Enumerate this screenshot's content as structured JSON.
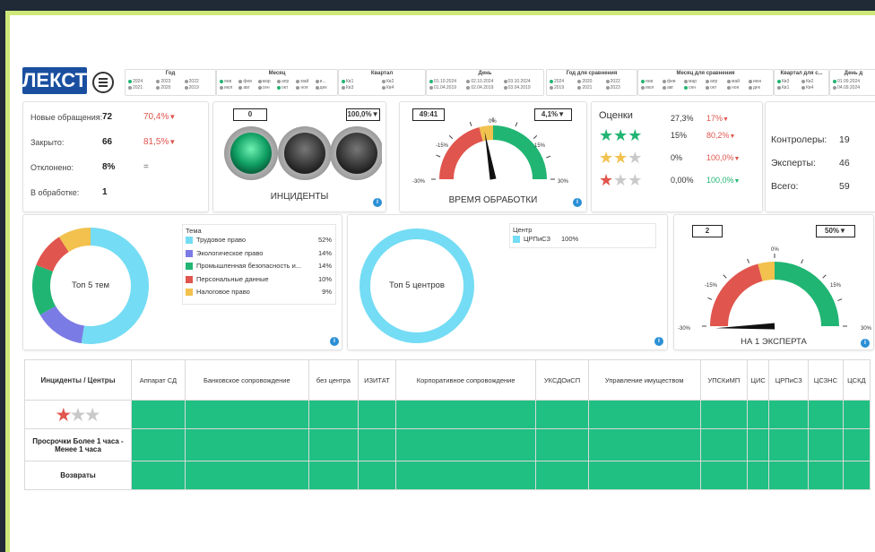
{
  "logo": {
    "text": "ЛЕКСТ"
  },
  "slicers": {
    "year": {
      "title": "Год",
      "items": [
        "2024",
        "2023",
        "2022",
        "2021",
        "2020",
        "2019"
      ]
    },
    "month": {
      "title": "Месяц",
      "items": [
        "янв",
        "фев",
        "мар",
        "апр",
        "май",
        "и...",
        "июл",
        "авг",
        "сен",
        "окт",
        "ноя",
        "дек"
      ]
    },
    "quarter": {
      "title": "Квартал",
      "items": [
        "Кв1",
        "Кв2",
        "Кв3",
        "Кв4"
      ]
    },
    "day": {
      "title": "День",
      "items": [
        "01.10.2024",
        "02.10.2024",
        "03.10.2024",
        "01.04.2019",
        "02.04.2019",
        "03.04.2019"
      ]
    },
    "year_cmp": {
      "title": "Год для сравнения",
      "items": [
        "2024",
        "2020",
        "2022",
        "2019",
        "2021",
        "2023"
      ]
    },
    "month_cmp": {
      "title": "Месяц для сравнения",
      "items": [
        "янв",
        "фев",
        "мар",
        "апр",
        "май",
        "июн",
        "июл",
        "авг",
        "сен",
        "окт",
        "ноя",
        "дек"
      ]
    },
    "quarter_cmp": {
      "title": "Квартал для с...",
      "items": [
        "Кв3",
        "Кв2",
        "Кв1",
        "Кв4"
      ]
    },
    "day_cmp": {
      "title": "День д",
      "items": [
        "01.09.2024",
        "04.09.2024"
      ]
    }
  },
  "kpi": {
    "rows": [
      {
        "label": "Новые обращения:",
        "value": "72",
        "pct": "70,4%"
      },
      {
        "label": "Закрыто:",
        "value": "66",
        "pct": "81,5%"
      },
      {
        "label": "Отклонено:",
        "value": "8%",
        "pct": "="
      },
      {
        "label": "В обработке:",
        "value": "1",
        "pct": ""
      }
    ]
  },
  "incidents": {
    "count": "0",
    "pct": "100,0%",
    "caption": "ИНЦИДЕНТЫ"
  },
  "processing": {
    "time": "49:41",
    "pct": "4,1%",
    "caption": "ВРЕМЯ ОБРАБОТКИ",
    "ticks": [
      "-15%",
      "0%",
      "15%",
      "-30%",
      "30%"
    ]
  },
  "ratings": {
    "title": "Оценки",
    "rows": [
      {
        "stars": 3,
        "share": "27,3%",
        "delta": "17%",
        "color": "#21b573",
        "dir": "down"
      },
      {
        "stars": 3,
        "share": "15%",
        "delta": "80,2%",
        "color": "#21b573",
        "dir": "down"
      },
      {
        "stars": 2,
        "share": "0%",
        "delta": "100,0%",
        "color": "#f2c14e",
        "dir": "down"
      },
      {
        "stars": 1,
        "share": "0,00%",
        "delta": "100,0%",
        "color": "#e0554d",
        "dir": "up"
      }
    ]
  },
  "staff": {
    "rows": [
      {
        "label": "Контролеры:",
        "value": "19"
      },
      {
        "label": "Эксперты:",
        "value": "46"
      },
      {
        "label": "Всего:",
        "value": "59"
      }
    ]
  },
  "topics": {
    "center_label": "Топ 5 тем",
    "legend_title": "Тема",
    "items": [
      {
        "name": "Трудовое право",
        "pct": "52%",
        "value": 52,
        "color": "#74dcf4"
      },
      {
        "name": "Экологическое право",
        "pct": "14%",
        "value": 14,
        "color": "#7b7be6"
      },
      {
        "name": "Промышленная безопасность и...",
        "pct": "14%",
        "value": 14,
        "color": "#21b573"
      },
      {
        "name": "Персональные данные",
        "pct": "10%",
        "value": 10,
        "color": "#e0554d"
      },
      {
        "name": "Налоговое право",
        "pct": "9%",
        "value": 9,
        "color": "#f2c14e"
      }
    ]
  },
  "centers": {
    "center_label": "Топ 5 центров",
    "legend_title": "Центр",
    "items": [
      {
        "name": "ЦРПиСЗ",
        "pct": "100%",
        "value": 100,
        "color": "#74dcf4"
      }
    ]
  },
  "per_expert": {
    "count": "2",
    "pct": "50%",
    "caption": "НА 1 ЭКСПЕРТА",
    "ticks": [
      "-15%",
      "0%",
      "15%",
      "-30%",
      "30%"
    ]
  },
  "matrix": {
    "corner": "Инциденты / Центры",
    "columns": [
      "Аппарат СД",
      "Банковское сопровождение",
      "без центра",
      "ИЗИТАТ",
      "Корпоративное сопровождение",
      "УКСДОиСП",
      "Управление имуществом",
      "УПСКиМП",
      "ЦИС",
      "ЦРПиСЗ",
      "ЦСЗНС",
      "ЦСКД"
    ],
    "rows": [
      {
        "label": ""
      },
      {
        "label": "Просрочки Более 1 часа - Менее 1 часа"
      },
      {
        "label": "Возвраты"
      }
    ]
  },
  "colors": {
    "green": "#21b573",
    "red": "#e0554d",
    "yellow": "#f2c14e",
    "cyan": "#74dcf4"
  }
}
